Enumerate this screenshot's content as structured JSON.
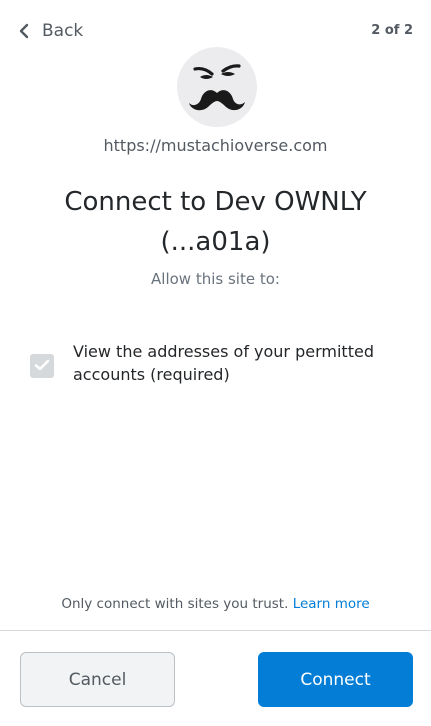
{
  "header": {
    "back_label": "Back",
    "step_label": "2 of 2"
  },
  "site": {
    "avatar_icon": "mustache-face-icon",
    "origin": "https://mustachioverse.com"
  },
  "title": {
    "line1": "Connect to Dev OWNLY",
    "line2": "(...a01a)"
  },
  "subtitle": "Allow this site to:",
  "permissions": [
    {
      "label": "View the addresses of your permitted accounts (required)",
      "checked": true,
      "disabled": true
    }
  ],
  "footer": {
    "trust_text": "Only connect with sites you trust.",
    "learn_more": "Learn more"
  },
  "actions": {
    "cancel_label": "Cancel",
    "connect_label": "Connect"
  },
  "colors": {
    "primary": "#037dd6",
    "text": "#24272a",
    "muted": "#535a61",
    "checkbox_disabled": "#d6d9dc"
  }
}
